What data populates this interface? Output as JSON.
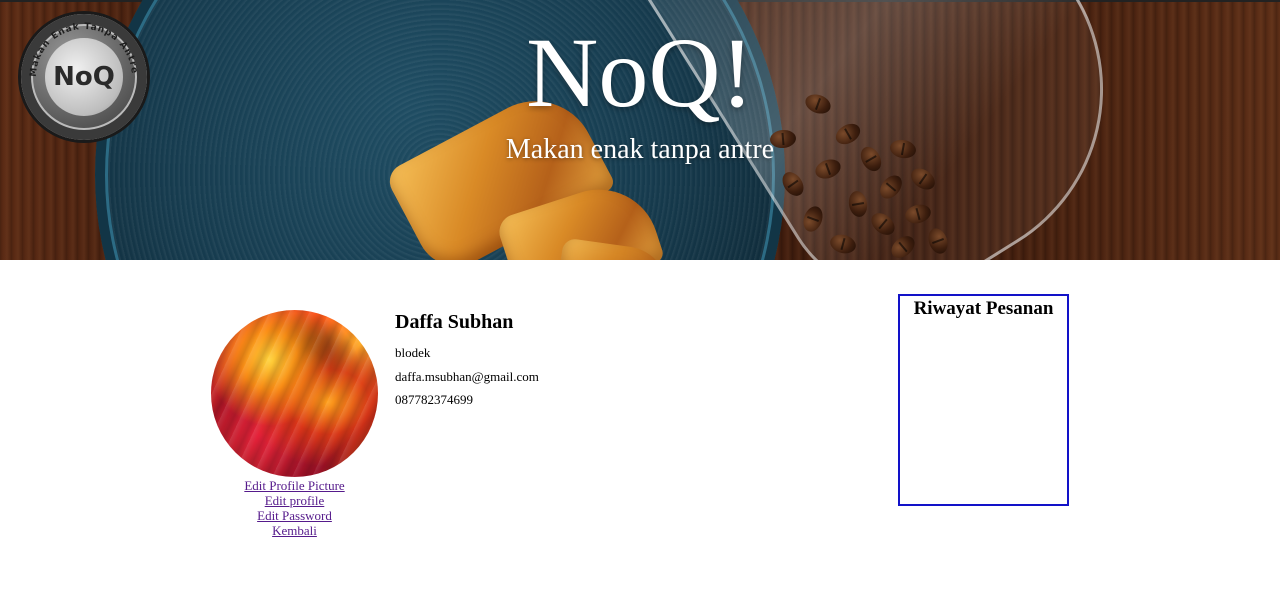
{
  "header": {
    "title": "NoQ!",
    "tagline": "Makan enak tanpa antre",
    "logo_text": "NoQ",
    "logo_ring_text": "Makan Enak Tanpa Antre"
  },
  "profile": {
    "name": "Daffa Subhan",
    "username": "blodek",
    "email": "daffa.msubhan@gmail.com",
    "phone": "087782374699",
    "links": {
      "edit_picture": "Edit Profile Picture",
      "edit_profile": "Edit profile",
      "edit_password": "Edit Password",
      "back": "Kembali"
    }
  },
  "history": {
    "title": "Riwayat Pesanan"
  },
  "colors": {
    "link": "#551a8b",
    "history_border": "#1212c8"
  }
}
